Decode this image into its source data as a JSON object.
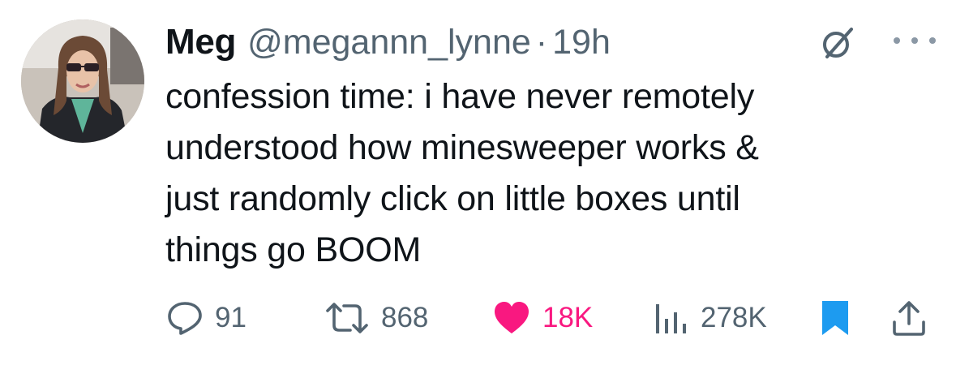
{
  "tweet": {
    "author_name": "Meg",
    "handle": "@megannn_lynne",
    "separator": "·",
    "time": "19h",
    "text_lines": [
      "confession time: i have never remotely",
      "understood how minesweeper works &",
      "just randomly click on little boxes until",
      "things go BOOM"
    ]
  },
  "icons": {
    "avatar": "profile-photo",
    "grok": "grok-slash-icon",
    "more": "more-dots-icon",
    "reply": "reply-bubble-icon",
    "retweet": "retweet-arrows-icon",
    "like": "heart-icon",
    "views": "bar-chart-icon",
    "bookmark": "bookmark-icon",
    "share": "share-upload-icon"
  },
  "actions": {
    "replies": "91",
    "retweets": "868",
    "likes": "18K",
    "views": "278K"
  },
  "colors": {
    "text": "#0f1419",
    "secondary": "#536471",
    "like": "#f91880",
    "bookmark": "#1d9bf0"
  }
}
